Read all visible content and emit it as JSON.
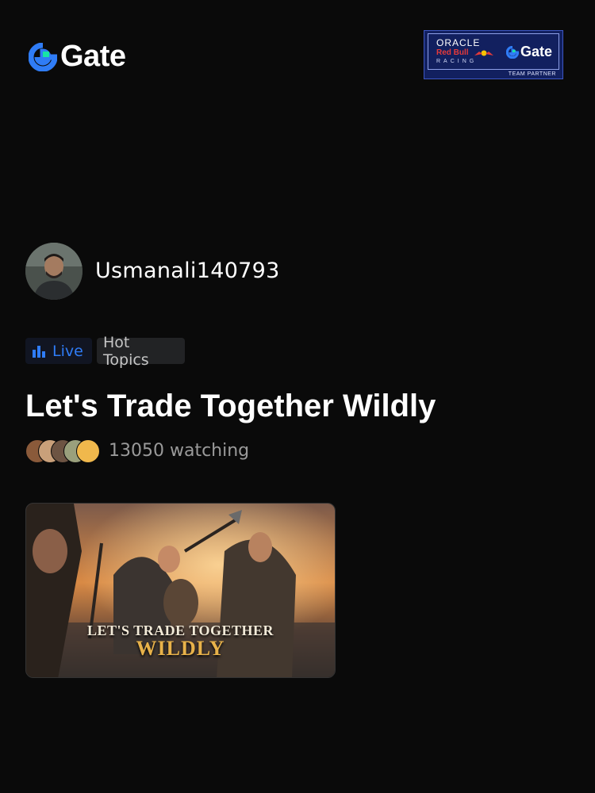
{
  "header": {
    "brand": "Gate",
    "partner_badge": {
      "line1": "ORACLE",
      "line2": "Red Bull",
      "line3": "RACING",
      "brand": "Gate",
      "caption": "TEAM PARTNER"
    }
  },
  "host": {
    "username": "Usmanali140793",
    "avatar_icon": "user-avatar"
  },
  "tags": {
    "live_label": "Live",
    "live_color": "#2f7cf6",
    "topic_label": "Hot Topics"
  },
  "stream": {
    "title": "Let's Trade Together Wildly",
    "watching_text": "13050 watching",
    "thumbnail_text_line1": "LET'S TRADE TOGETHER",
    "thumbnail_text_line2": "WILDLY"
  },
  "colors": {
    "background": "#0a0a0a",
    "brand_blue": "#2f7cf6",
    "brand_green": "#17e5a5"
  }
}
